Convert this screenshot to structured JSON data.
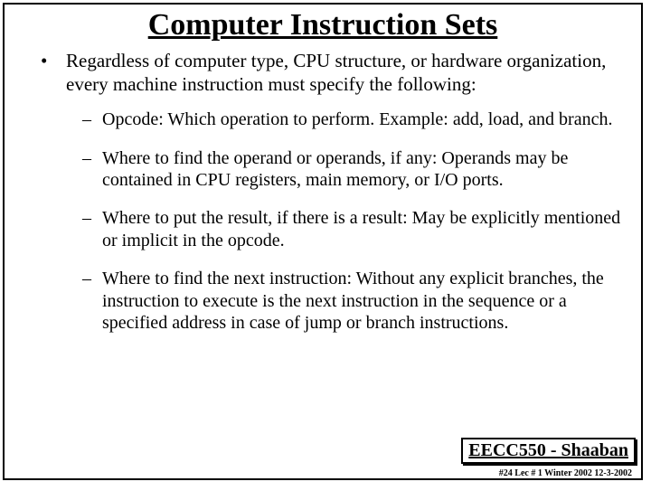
{
  "title": "Computer Instruction Sets",
  "intro": "Regardless of computer type, CPU structure, or hardware organization, every machine instruction must specify the following:",
  "points": {
    "p0": "Opcode:  Which operation to perform.  Example: add, load, and branch.",
    "p1": "Where to find the operand or operands, if any:  Operands may be contained in CPU registers, main memory, or I/O ports.",
    "p2": "Where to put the result, if there is a result:  May be explicitly mentioned or implicit in the opcode.",
    "p3": "Where to find the next instruction:  Without any explicit branches, the instruction to execute is the next instruction in the sequence or a specified address in case of jump or branch instructions."
  },
  "footer": "EECC550 - Shaaban",
  "subfooter": "#24  Lec # 1 Winter 2002  12-3-2002"
}
